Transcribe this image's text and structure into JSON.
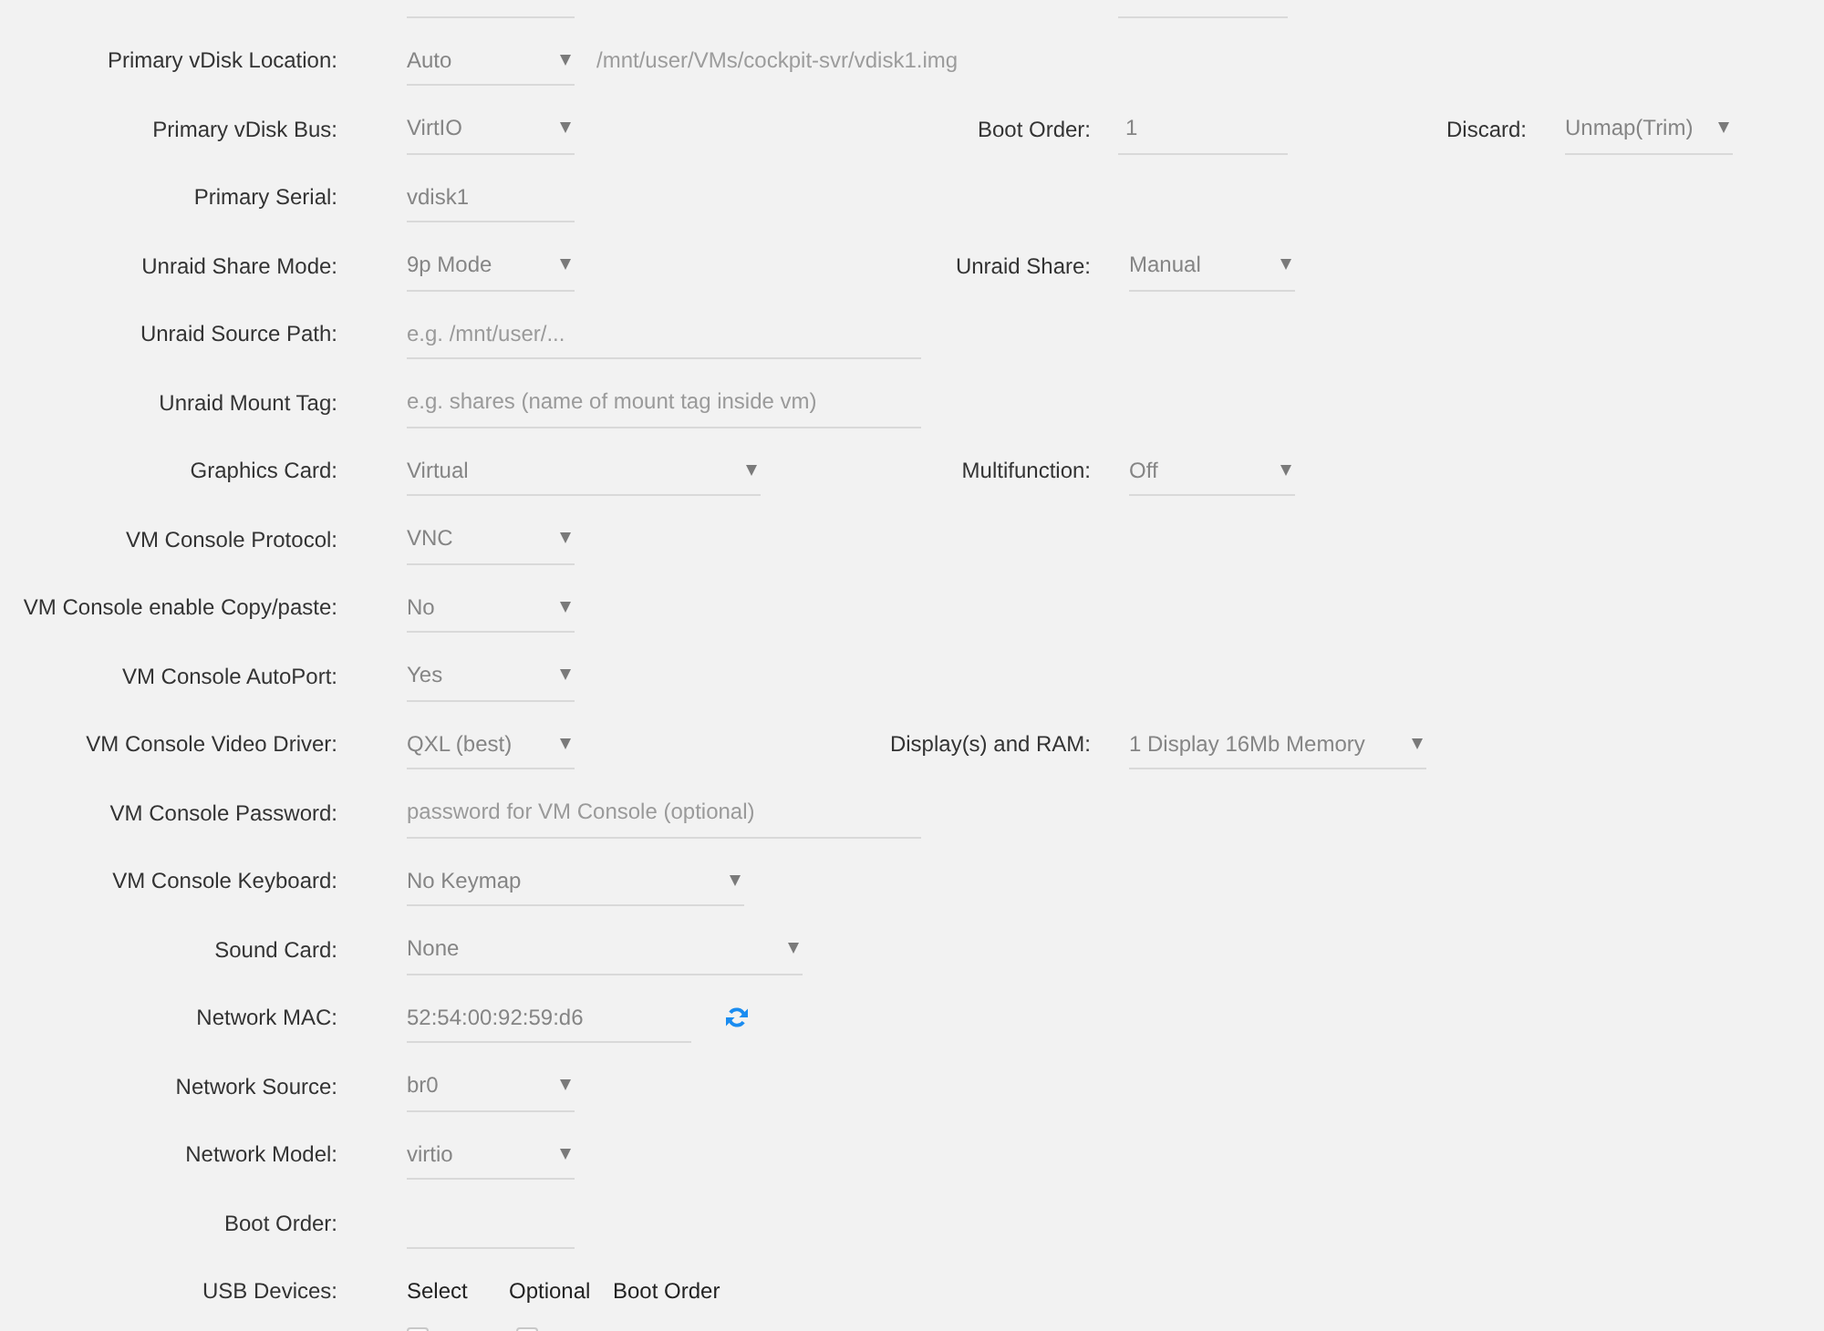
{
  "form": {
    "rows": [
      {
        "control": {
          "kind": "input"
        },
        "side": [
          {
            "control": {
              "kind": "input"
            }
          }
        ]
      },
      {
        "label": "Primary vDisk Location:",
        "control": {
          "kind": "select",
          "value": "Auto"
        },
        "note": "/mnt/user/VMs/cockpit-svr/vdisk1.img"
      },
      {
        "label": "Primary vDisk Bus:",
        "control": {
          "kind": "select",
          "value": "VirtIO"
        },
        "side": [
          {
            "label": "Boot Order:",
            "control": {
              "kind": "input",
              "value": "1"
            }
          },
          {
            "label": "Discard:",
            "control": {
              "kind": "select",
              "value": "Unmap(Trim)"
            }
          }
        ]
      },
      {
        "label": "Primary Serial:",
        "control": {
          "kind": "input",
          "value": "vdisk1"
        }
      },
      {
        "label": "Unraid Share Mode:",
        "control": {
          "kind": "select",
          "value": "9p Mode"
        },
        "side": [
          {
            "label": "Unraid Share:",
            "control": {
              "kind": "select",
              "value": "Manual"
            }
          }
        ]
      },
      {
        "label": "Unraid Source Path:",
        "control": {
          "kind": "input",
          "placeholder": "e.g. /mnt/user/..."
        }
      },
      {
        "label": "Unraid Mount Tag:",
        "control": {
          "kind": "input",
          "placeholder": "e.g. shares (name of mount tag inside vm)"
        }
      },
      {
        "label": "Graphics Card:",
        "control": {
          "kind": "select",
          "value": "Virtual"
        },
        "side": [
          {
            "label": "Multifunction:",
            "control": {
              "kind": "select",
              "value": "Off"
            }
          }
        ]
      },
      {
        "label": "VM Console Protocol:",
        "control": {
          "kind": "select",
          "value": "VNC"
        }
      },
      {
        "label": "VM Console enable Copy/paste:",
        "control": {
          "kind": "select",
          "value": "No"
        }
      },
      {
        "label": "VM Console AutoPort:",
        "control": {
          "kind": "select",
          "value": "Yes"
        }
      },
      {
        "label": "VM Console Video Driver:",
        "control": {
          "kind": "select",
          "value": "QXL (best)"
        },
        "side": [
          {
            "label": "Display(s) and RAM:",
            "control": {
              "kind": "select",
              "value": "1 Display 16Mb Memory"
            }
          }
        ]
      },
      {
        "label": "VM Console Password:",
        "control": {
          "kind": "input",
          "placeholder": "password for VM Console (optional)"
        }
      },
      {
        "label": "VM Console Keyboard:",
        "control": {
          "kind": "select",
          "value": "No Keymap"
        }
      },
      {
        "label": "Sound Card:",
        "control": {
          "kind": "select",
          "value": "None"
        }
      },
      {
        "label": "Network MAC:",
        "control": {
          "kind": "refreshable",
          "value": "52:54:00:92:59:d6"
        }
      },
      {
        "label": "Network Source:",
        "control": {
          "kind": "select",
          "value": "br0"
        }
      },
      {
        "label": "Network Model:",
        "control": {
          "kind": "select",
          "value": "virtio"
        }
      },
      {
        "label": "Boot Order:",
        "control": {
          "kind": "input"
        }
      },
      {
        "label": "USB Devices:",
        "control": {
          "kind": "headers",
          "columns": [
            "Select",
            "Optional",
            "Boot Order"
          ]
        }
      },
      {
        "control": {
          "kind": "checkboxes",
          "items": [
            {
              "checked": false
            },
            {
              "checked": false
            }
          ]
        }
      }
    ]
  }
}
